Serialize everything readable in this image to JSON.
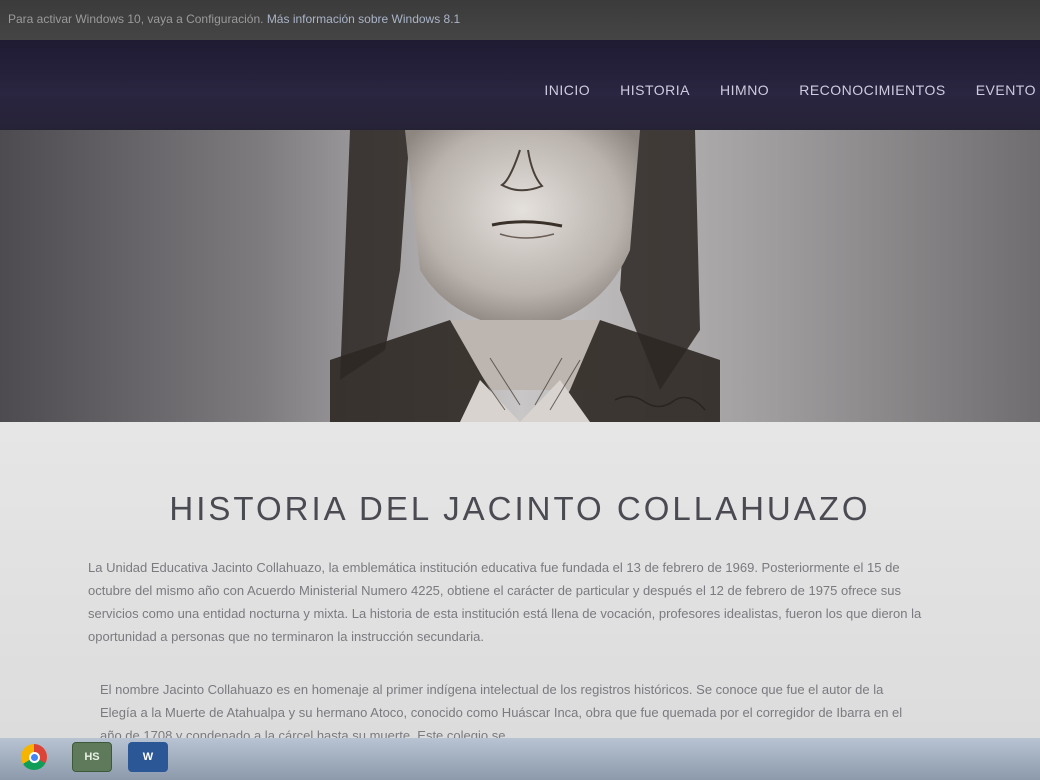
{
  "activation_notice": {
    "text": "Para activar Windows 10, vaya a Configuración.",
    "link": "Más información sobre Windows 8.1"
  },
  "nav": {
    "items": [
      "INICIO",
      "HISTORIA",
      "HIMNO",
      "RECONOCIMIENTOS",
      "EVENTO"
    ]
  },
  "hero": {
    "image": "portrait-sketch-jacinto-collahuazo"
  },
  "content": {
    "title": "HISTORIA DEL JACINTO COLLAHUAZO",
    "paragraph_1": "La Unidad Educativa Jacinto Collahuazo, la emblemática institución educativa fue fundada el 13 de febrero de 1969. Posteriormente el 15 de octubre del mismo año con Acuerdo Ministerial Numero 4225, obtiene el carácter de particular y después el 12 de febrero de 1975 ofrece sus servicios como una entidad nocturna y mixta. La historia de esta institución está llena de vocación, profesores idealistas, fueron los que dieron la oportunidad a personas que no terminaron la instrucción secundaria.",
    "paragraph_2": "El nombre Jacinto Collahuazo es en homenaje al primer indígena intelectual de los registros históricos. Se conoce que fue el autor de la Elegía a la Muerte de Atahualpa y su hermano Atoco, conocido como Huáscar Inca, obra que fue quemada por el corregidor de Ibarra en el año de 1708 y condenado a la cárcel hasta su muerte. Este colegio se"
  },
  "taskbar": {
    "icons": [
      "chrome-icon",
      "hs-icon",
      "word-icon"
    ],
    "hs_label": "HS",
    "word_label": "W"
  }
}
